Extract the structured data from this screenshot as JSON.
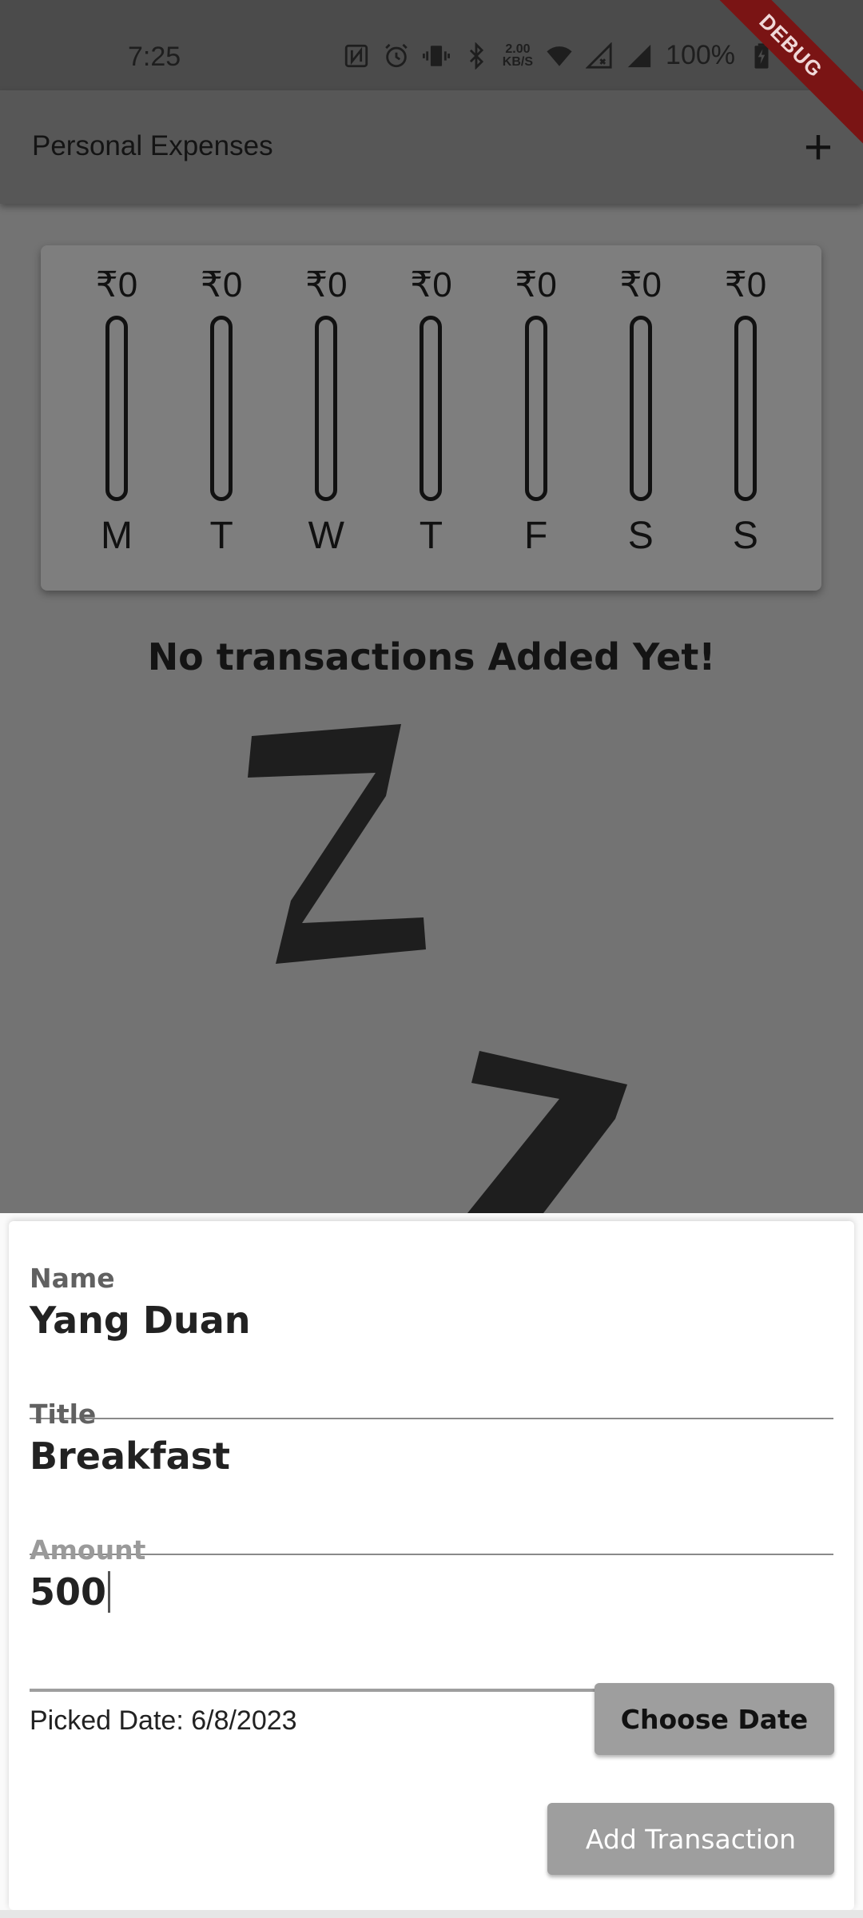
{
  "status_bar": {
    "time": "7:25",
    "net_speed_value": "2.00",
    "net_speed_unit": "KB/S",
    "battery": "100%",
    "icons": [
      "nfc-icon",
      "alarm-icon",
      "vibrate-icon",
      "bluetooth-icon",
      "wifi-icon",
      "signal-x-icon",
      "signal-icon",
      "battery-charging-icon"
    ]
  },
  "debug_banner": "DEBUG",
  "app_bar": {
    "title": "Personal Expenses",
    "add_icon": "+"
  },
  "chart_data": {
    "type": "bar",
    "categories": [
      "M",
      "T",
      "W",
      "T",
      "F",
      "S",
      "S"
    ],
    "values": [
      0,
      0,
      0,
      0,
      0,
      0,
      0
    ],
    "value_labels": [
      "₹0",
      "₹0",
      "₹0",
      "₹0",
      "₹0",
      "₹0",
      "₹0"
    ],
    "currency": "₹"
  },
  "empty_state": {
    "message": "No transactions Added Yet!",
    "image": "zz-sleep-image"
  },
  "form": {
    "name_label": "Name",
    "name_value": "Yang Duan",
    "title_label": "Title",
    "title_value": "Breakfast",
    "amount_label": "Amount",
    "amount_value": "500",
    "picked_date": "Picked Date: 6/8/2023",
    "choose_date_label": "Choose Date",
    "add_transaction_label": "Add Transaction"
  },
  "colors": {
    "status_bar": "#4b4b4b",
    "app_bar": "#575757",
    "body_dim": "#737373",
    "button_grey": "#9e9e9e",
    "debug": "#7a1414"
  }
}
